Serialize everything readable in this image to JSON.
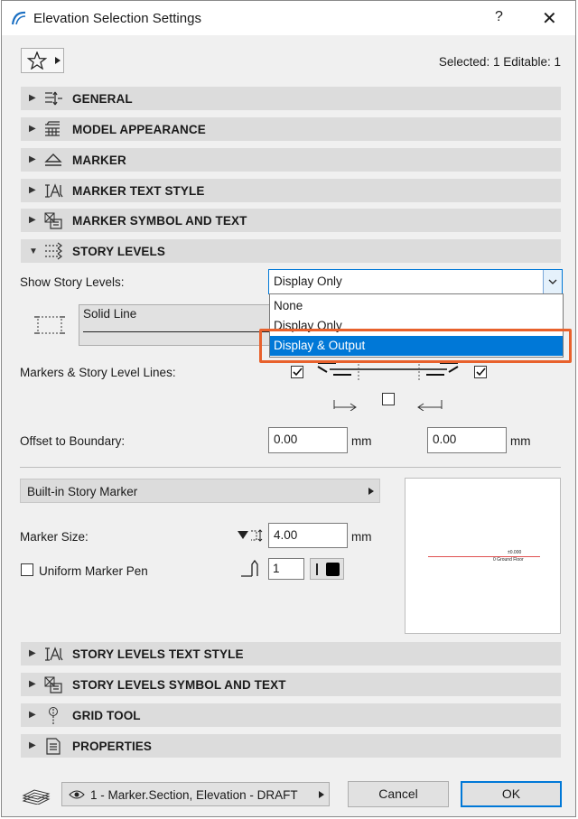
{
  "window": {
    "title": "Elevation Selection Settings",
    "help": "?",
    "close": "✕"
  },
  "header": {
    "selected_info": "Selected: 1 Editable: 1"
  },
  "sections_top": [
    {
      "label": "GENERAL",
      "icon": "general-icon"
    },
    {
      "label": "MODEL APPEARANCE",
      "icon": "model-appearance-icon"
    },
    {
      "label": "MARKER",
      "icon": "marker-icon"
    },
    {
      "label": "MARKER TEXT STYLE",
      "icon": "marker-text-style-icon"
    },
    {
      "label": "MARKER SYMBOL AND TEXT",
      "icon": "marker-symbol-icon"
    }
  ],
  "story_levels": {
    "header": "STORY LEVELS",
    "show_label": "Show Story Levels:",
    "show_value": "Display Only",
    "options": [
      "None",
      "Display Only",
      "Display & Output"
    ],
    "highlighted_option": "Display & Output",
    "line_type": "Solid Line",
    "markers_lines_label": "Markers & Story Level Lines:",
    "offset_label": "Offset to Boundary:",
    "offset_left": "0.00",
    "offset_right": "0.00",
    "unit": "mm",
    "marker_type": "Built-in Story Marker",
    "marker_size_label": "Marker Size:",
    "marker_size": "4.00",
    "uniform_pen_label": "Uniform Marker Pen",
    "pen_number": "1",
    "preview_elev": "±0.000",
    "preview_floor": "0 Ground Floor"
  },
  "sections_bottom": [
    {
      "label": "STORY LEVELS TEXT STYLE",
      "icon": "text-style-icon"
    },
    {
      "label": "STORY LEVELS SYMBOL AND TEXT",
      "icon": "symbol-text-icon"
    },
    {
      "label": "GRID TOOL",
      "icon": "grid-tool-icon"
    },
    {
      "label": "PROPERTIES",
      "icon": "properties-icon"
    }
  ],
  "footer": {
    "layer": "1 - Marker.Section, Elevation - DRAFT",
    "cancel": "Cancel",
    "ok": "OK"
  },
  "colors": {
    "highlight": "#0078d7",
    "annotation": "#e8612c",
    "accent_line": "#e05050"
  }
}
